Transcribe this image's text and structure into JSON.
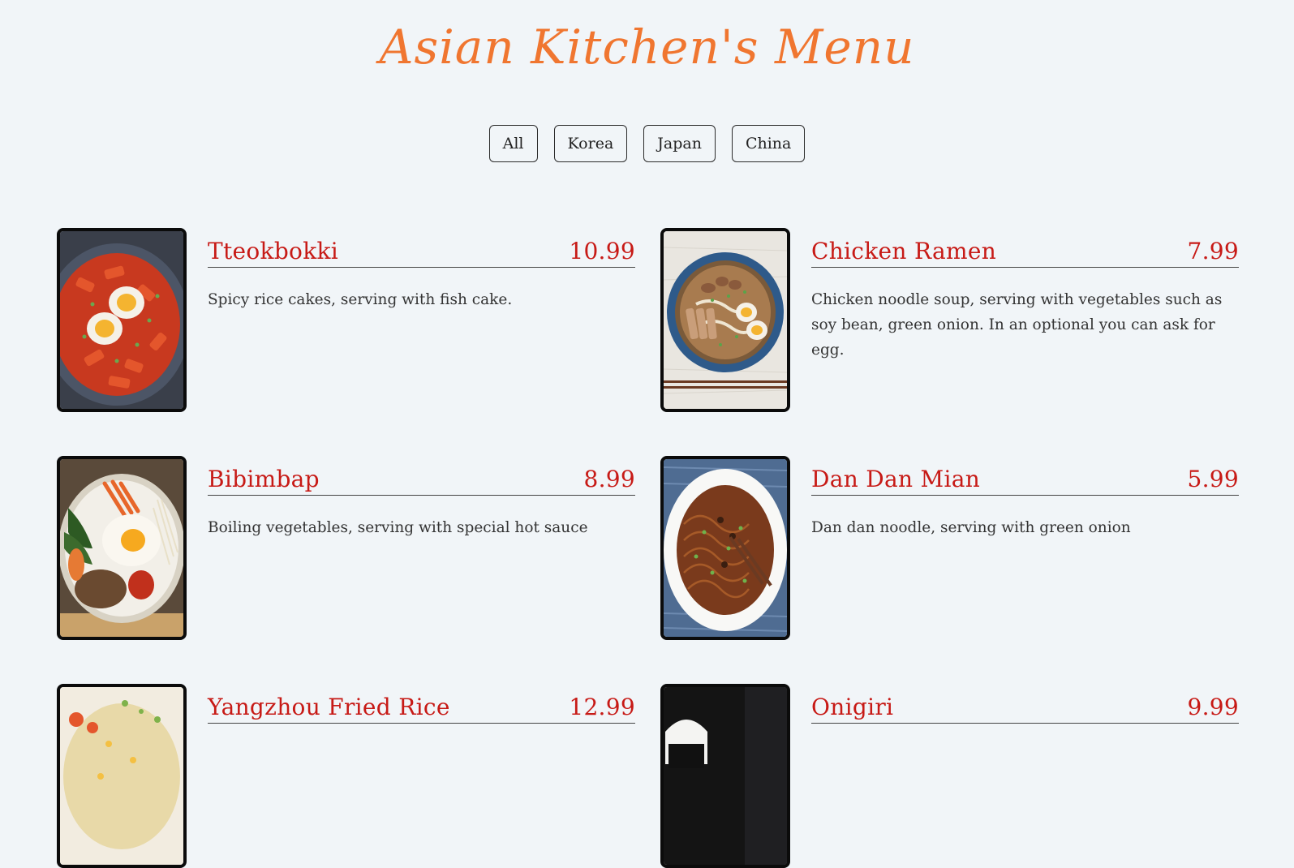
{
  "title": "Asian Kitchen's Menu",
  "filters": [
    "All",
    "Korea",
    "Japan",
    "China"
  ],
  "colors": {
    "background": "#f1f5f8",
    "title": "#f07630",
    "item_name": "#c71a16",
    "text": "#333333"
  },
  "items": [
    {
      "name": "Tteokbokki",
      "price": "10.99",
      "desc": "Spicy rice cakes, serving with fish cake.",
      "photo_icon": "tteokbokki-photo"
    },
    {
      "name": "Chicken Ramen",
      "price": "7.99",
      "desc": "Chicken noodle soup, serving with vegetables such as soy bean, green onion. In an optional you can ask for egg.",
      "photo_icon": "chicken-ramen-photo"
    },
    {
      "name": "Bibimbap",
      "price": "8.99",
      "desc": "Boiling vegetables, serving with special hot sauce",
      "photo_icon": "bibimbap-photo"
    },
    {
      "name": "Dan Dan Mian",
      "price": "5.99",
      "desc": "Dan dan noodle, serving with green onion",
      "photo_icon": "dan-dan-mian-photo"
    },
    {
      "name": "Yangzhou Fried Rice",
      "price": "12.99",
      "desc": "",
      "photo_icon": "yangzhou-fried-rice-photo"
    },
    {
      "name": "Onigiri",
      "price": "9.99",
      "desc": "",
      "photo_icon": "onigiri-photo"
    }
  ]
}
